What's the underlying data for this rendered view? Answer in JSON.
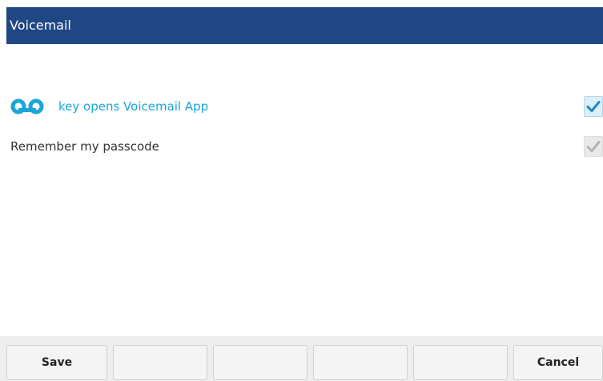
{
  "header": {
    "title": "Voicemail"
  },
  "options": [
    {
      "label": "key opens Voicemail App",
      "icon": "voicemail-icon",
      "checked": true,
      "enabled": true
    },
    {
      "label": "Remember my passcode",
      "checked": true,
      "enabled": false
    }
  ],
  "softkeys": [
    {
      "label": "Save"
    },
    {
      "label": ""
    },
    {
      "label": ""
    },
    {
      "label": ""
    },
    {
      "label": ""
    },
    {
      "label": "Cancel"
    }
  ],
  "colors": {
    "title_bar": "#1f4784",
    "accent": "#1aa6d9",
    "check_active": "#1e88c8",
    "check_disabled": "#b3b3b3"
  }
}
